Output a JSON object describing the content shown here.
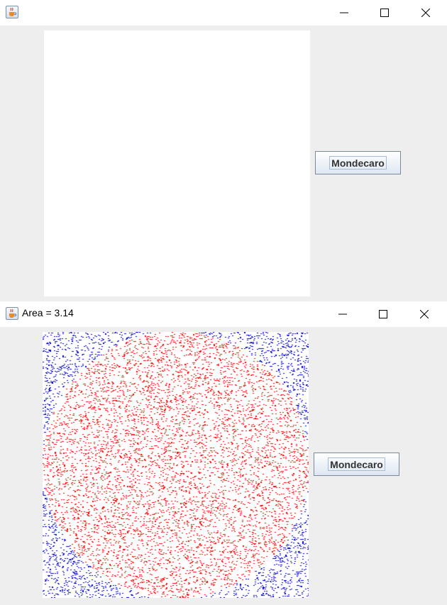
{
  "windows": [
    {
      "title": "",
      "icon": "java-cup-icon",
      "controls": [
        "minimize-icon",
        "maximize-icon",
        "close-icon"
      ],
      "button_label": "Mondecaro",
      "simulation_state": "empty"
    },
    {
      "title": "Area = 3.14",
      "icon": "java-cup-icon",
      "controls": [
        "minimize-icon",
        "maximize-icon",
        "close-icon"
      ],
      "button_label": "Mondecaro",
      "simulation_state": "scattered points",
      "inside_color": "#ff0000",
      "outside_color": "#0000cc",
      "canvas_background": "#ffffff"
    }
  ]
}
